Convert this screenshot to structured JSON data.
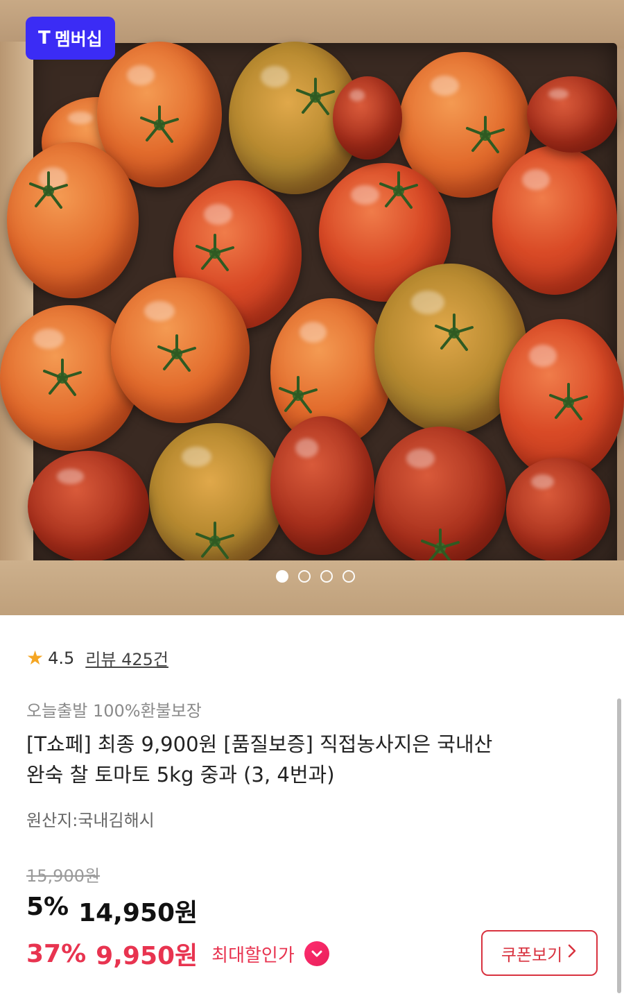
{
  "membership_badge": {
    "logo": "T",
    "label": "멤버십",
    "color": "#3b2cf5"
  },
  "carousel": {
    "total": 4,
    "active_index": 0
  },
  "rating": {
    "icon": "star-icon",
    "value": "4.5",
    "reviews_label": "리뷰 425건"
  },
  "tagline": "오늘출발 100%환불보장",
  "product": {
    "title_line1": "[T쇼페] 최종 9,900원 [품질보증] 직접농사지은 국내산",
    "title_line2": "완숙 찰 토마토 5kg 중과 (3, 4번과)",
    "origin": "원산지:국내김해시"
  },
  "pricing": {
    "original_price": "15,900원",
    "sale_percent": "5%",
    "sale_price": "14,950원",
    "max_percent": "37%",
    "max_price": "9,950원",
    "max_label": "최대할인가",
    "accent_color": "#e83450"
  },
  "coupon_button": {
    "label": "쿠폰보기",
    "icon": "chevron-right-icon"
  }
}
